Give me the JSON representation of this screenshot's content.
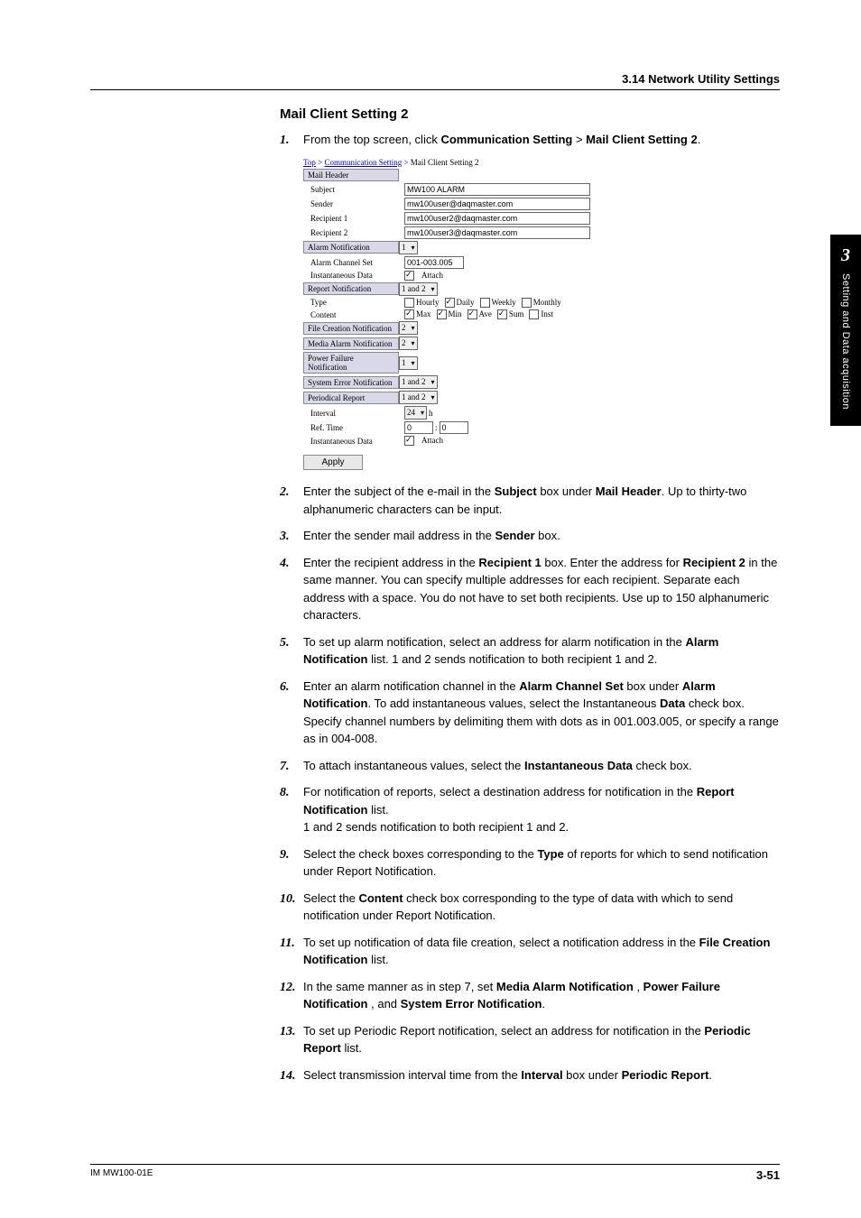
{
  "header": {
    "section": "3.14  Network Utility Settings"
  },
  "title": "Mail Client Setting 2",
  "side": {
    "chapter": "3",
    "label": "Setting and Data acquisition"
  },
  "footer": {
    "manual": "IM MW100-01E",
    "page": "3-51"
  },
  "shot": {
    "breadcrumb": {
      "a": "Top",
      "b": "Communication Setting",
      "c": "Mail Client Setting 2"
    },
    "mailHeader": "Mail Header",
    "labels": {
      "subject": "Subject",
      "sender": "Sender",
      "r1": "Recipient 1",
      "r2": "Recipient 2",
      "alarmNotif": "Alarm Notification",
      "alarmSet": "Alarm Channel Set",
      "inst": "Instantaneous Data",
      "reportNotif": "Report Notification",
      "type": "Type",
      "content": "Content",
      "fileNotif": "File Creation Notification",
      "mediaNotif": "Media Alarm Notification",
      "powerNotif": "Power Failure Notification",
      "sysErr": "System Error Notification",
      "periodical": "Periodical Report",
      "interval": "Interval",
      "refTime": "Ref. Time",
      "inst2": "Instantaneous Data"
    },
    "values": {
      "subject": "MW100 ALARM",
      "sender": "mw100user@daqmaster.com",
      "r1": "mw100user2@daqmaster.com",
      "r2": "mw100user3@daqmaster.com",
      "alarmNotif": "1",
      "alarmSet": "001-003.005",
      "attach": "Attach",
      "reportNotif": "1 and 2",
      "type": {
        "hourly": "Hourly",
        "daily": "Daily",
        "weekly": "Weekly",
        "monthly": "Monthly"
      },
      "content": {
        "max": "Max",
        "min": "Min",
        "ave": "Ave",
        "sum": "Sum",
        "inst": "Inst"
      },
      "fileNotif": "2",
      "mediaNotif": "2",
      "powerNotif": "1",
      "sysErr": "1 and 2",
      "periodical": "1 and 2",
      "interval": "24",
      "intervalUnit": "h",
      "refH": "0",
      "refM": "0"
    },
    "apply": "Apply"
  },
  "steps": [
    {
      "n": "1.",
      "pre": "From the top screen, click ",
      "b1": "Communication Setting",
      "sep": " > ",
      "b2": "Mail Client Setting 2",
      "post": "."
    },
    {
      "n": "2.",
      "t": "Enter the subject of the e-mail in the ",
      "b1": "Subject",
      "m1": " box under ",
      "b2": "Mail Header",
      "post": ". Up to thirty-two alphanumeric characters can be input."
    },
    {
      "n": "3.",
      "t": "Enter the sender mail address in the ",
      "b1": "Sender",
      "post": " box."
    },
    {
      "n": "4.",
      "t": "Enter the recipient address in the ",
      "b1": "Recipient 1",
      "m1": " box. Enter the address for ",
      "b2": "Recipient 2",
      "post": " in the same manner. You can specify multiple addresses for each recipient. Separate each address with a space. You do not have to set both recipients. Use up to 150 alphanumeric characters."
    },
    {
      "n": "5.",
      "t": "To set up alarm notification, select an address for alarm notification in the ",
      "b1": "Alarm Notification",
      "post": " list. 1 and 2 sends notification to both recipient 1 and 2."
    },
    {
      "n": "6.",
      "t": "Enter an alarm notification channel in the ",
      "b1": "Alarm Channel Set",
      "m1": " box under ",
      "b2": "Alarm Notification",
      "m2": ". To add instantaneous values, select the Instantaneous ",
      "b3": "Data",
      "post": " check box. Specify channel numbers by delimiting them with dots as in 001.003.005, or specify a range as in 004-008."
    },
    {
      "n": "7.",
      "t": "To attach instantaneous values, select the ",
      "b1": "Instantaneous Data",
      "post": " check box."
    },
    {
      "n": "8.",
      "t": "For notification of reports, select a destination address for notification in the ",
      "b1": "Report Notification",
      "post": " list.",
      "extra": "1 and 2 sends notification to both recipient 1 and 2."
    },
    {
      "n": "9.",
      "t": "Select the check boxes corresponding to the ",
      "b1": "Type",
      "post": " of reports for which to send notification under Report Notification."
    },
    {
      "n": "10.",
      "t": "Select the ",
      "b1": "Content",
      "post": " check box corresponding to the type of data with which to send notification under Report Notification."
    },
    {
      "n": "11.",
      "t": "To set up notification of data file creation, select a notification address in the ",
      "b1": "File Creation Notification",
      "post": " list."
    },
    {
      "n": "12.",
      "t": "In the same manner as in step 7, set ",
      "b1": "Media Alarm Notification",
      "m1": " , ",
      "b2": "Power Failure Notification",
      "m2": " , and ",
      "b3": "System Error Notification",
      "post": "."
    },
    {
      "n": "13.",
      "t": "To set up Periodic Report notification, select an address for notification in the ",
      "b1": "Periodic Report",
      "post": " list."
    },
    {
      "n": "14.",
      "t": "Select transmission interval time from the ",
      "b1": "Interval",
      "m1": " box under ",
      "b2": "Periodic Report",
      "post": "."
    }
  ]
}
